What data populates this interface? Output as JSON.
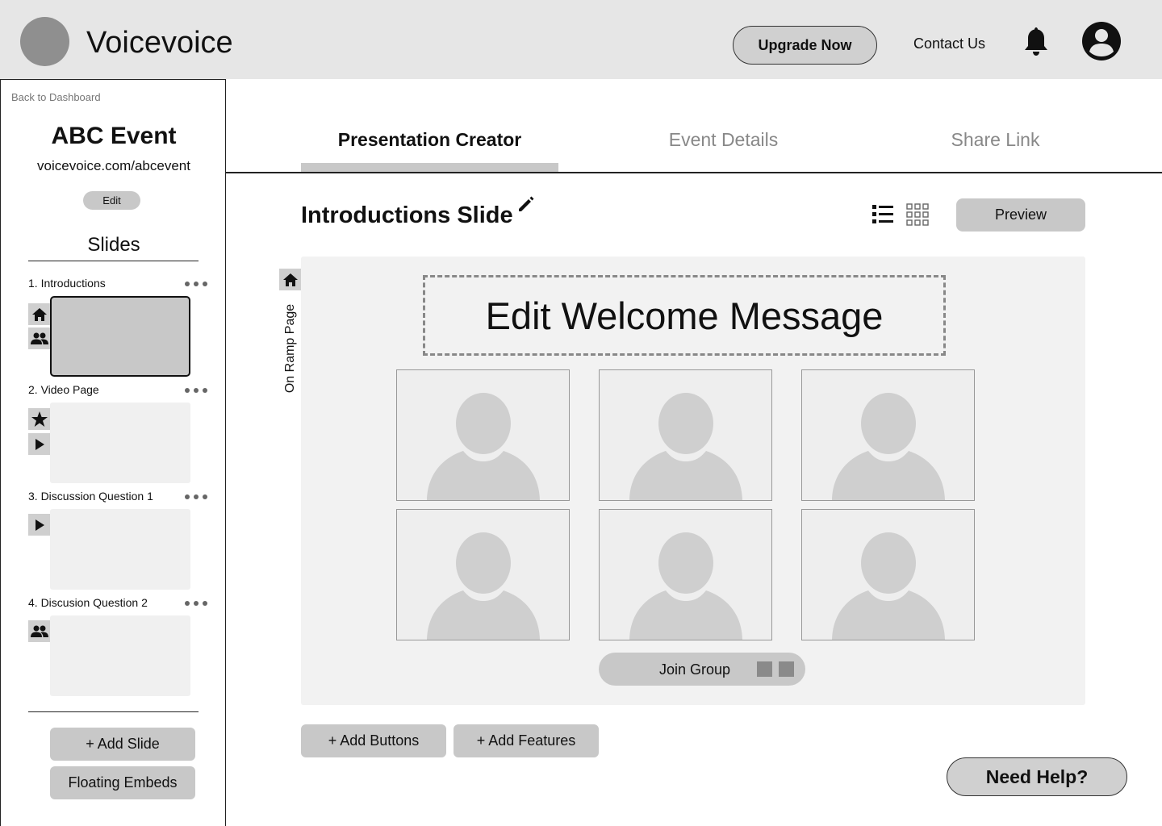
{
  "header": {
    "brand": "Voicevoice",
    "upgrade_label": "Upgrade Now",
    "contact_label": "Contact Us"
  },
  "sidebar": {
    "back_label": "Back to Dashboard",
    "event_title": "ABC Event",
    "event_url": "voicevoice.com/abcevent",
    "edit_label": "Edit",
    "slides_heading": "Slides",
    "slides": [
      {
        "label": "1. Introductions",
        "icons": [
          "home-icon",
          "group-icon"
        ],
        "active": true
      },
      {
        "label": "2. Video Page",
        "icons": [
          "star-icon",
          "play-icon"
        ],
        "active": false
      },
      {
        "label": "3. Discussion Question 1",
        "icons": [
          "play-icon"
        ],
        "active": false
      },
      {
        "label": "4. Discusion Question 2",
        "icons": [
          "group-icon"
        ],
        "active": false
      }
    ],
    "add_slide_label": "+ Add Slide",
    "floating_embeds_label": "Floating Embeds"
  },
  "tabs": [
    {
      "label": "Presentation Creator",
      "active": true
    },
    {
      "label": "Event Details",
      "active": false
    },
    {
      "label": "Share Link",
      "active": false
    }
  ],
  "editor": {
    "slide_title": "Introductions Slide",
    "preview_label": "Preview",
    "side_label": "On Ramp Page",
    "welcome_message": "Edit Welcome Message",
    "participant_tiles": 6,
    "join_group_label": "Join Group",
    "add_buttons_label": "+ Add Buttons",
    "add_features_label": "+ Add Features"
  },
  "help_label": "Need Help?"
}
